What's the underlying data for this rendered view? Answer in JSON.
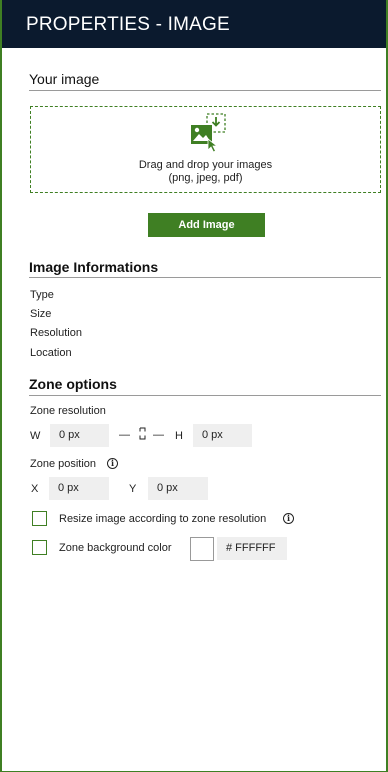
{
  "header": {
    "title": "PROPERTIES - IMAGE"
  },
  "your_image": {
    "title": "Your image",
    "drop_line1": "Drag and drop your images",
    "drop_line2": "(png, jpeg, pdf)",
    "add_button": "Add Image"
  },
  "image_info": {
    "title": "Image Informations",
    "rows": [
      "Type",
      "Size",
      "Resolution",
      "Location"
    ]
  },
  "zone_options": {
    "title": "Zone options",
    "resolution_label": "Zone resolution",
    "w_label": "W",
    "w_value": "0 px",
    "h_label": "H",
    "h_value": "0 px",
    "dash": "—",
    "position_label": "Zone position",
    "x_label": "X",
    "x_value": "0 px",
    "y_label": "Y",
    "y_value": "0 px",
    "resize_label": "Resize image according to zone resolution",
    "resize_checked": false,
    "bg_label": "Zone background color",
    "bg_checked": false,
    "bg_value": "# FFFFFF"
  },
  "colors": {
    "accent": "#3f7f23",
    "header_bg": "#0b1a2e",
    "input_bg": "#efefef"
  },
  "icons": {
    "drop": "image-upload-icon",
    "info": "info-icon",
    "link": "link-icon"
  }
}
